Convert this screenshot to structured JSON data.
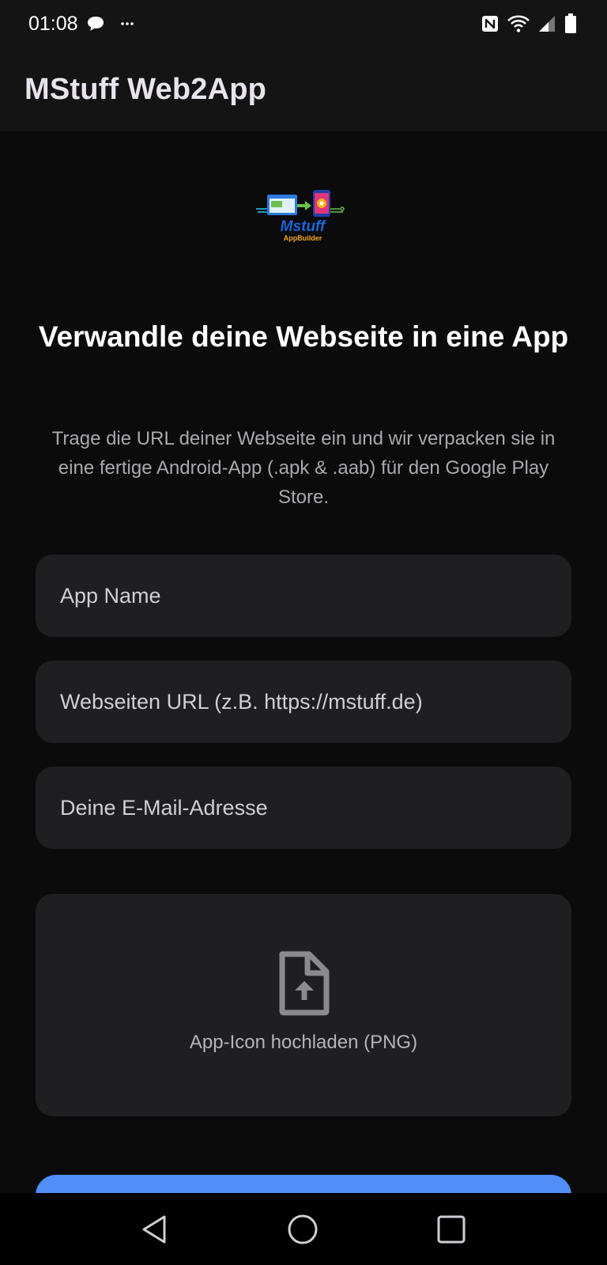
{
  "status_bar": {
    "time": "01:08",
    "notification_icons": [
      "chat-bubble-icon",
      "more-dots-icon"
    ],
    "system_icons": [
      "nfc-icon",
      "wifi-icon",
      "cell-signal-icon",
      "battery-icon"
    ]
  },
  "app_bar": {
    "title": "MStuff Web2App"
  },
  "hero": {
    "logo_text": "Mstuff",
    "logo_subtext": "AppBuilder",
    "headline": "Verwandle deine Webseite in eine App",
    "subtitle": "Trage die URL deiner Webseite ein und wir verpacken sie in eine fertige Android-App (.apk & .aab) für den Google Play Store."
  },
  "form": {
    "app_name_placeholder": "App Name",
    "url_placeholder": "Webseiten URL (z.B. https://mstuff.de)",
    "email_placeholder": "Deine E-Mail-Adresse",
    "upload_icon": "file-upload-icon",
    "upload_label": "App-Icon hochladen (PNG)"
  },
  "nav_bar": {
    "icons": [
      "back-triangle-icon",
      "home-circle-icon",
      "recents-square-icon"
    ]
  },
  "colors": {
    "background": "#0b0b0b",
    "bar_background": "#141414",
    "field_background": "#1f1f21",
    "accent": "#4f8ff7"
  }
}
